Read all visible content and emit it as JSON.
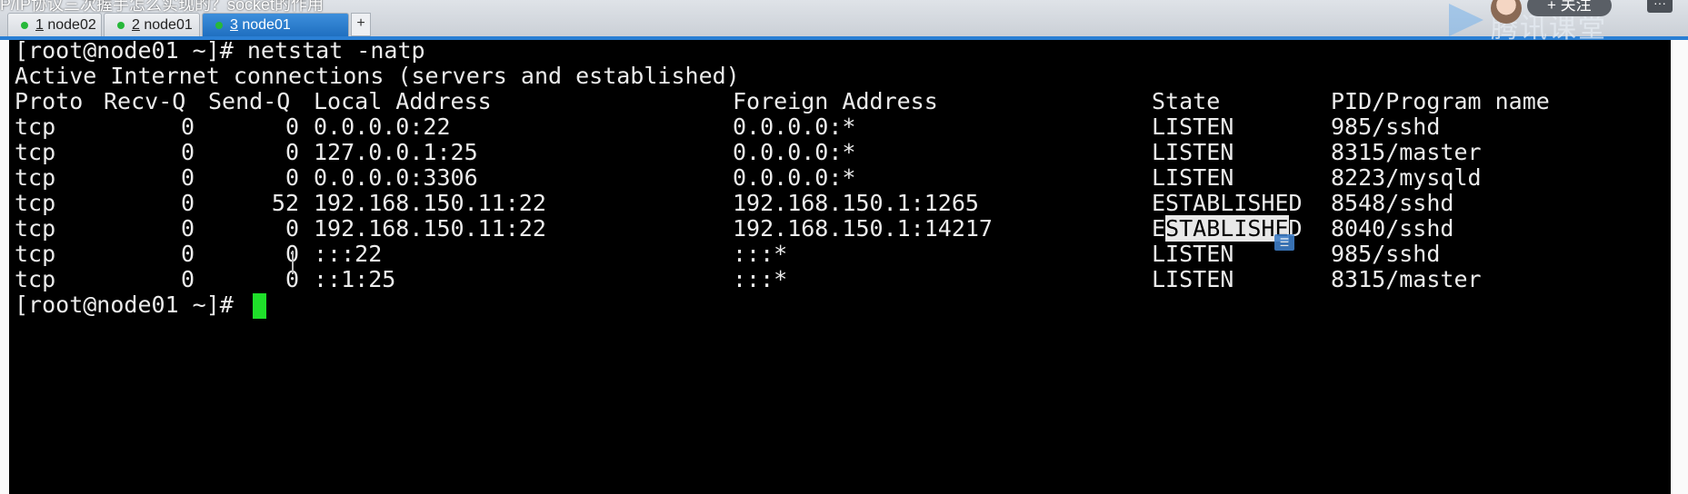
{
  "video_title": "P/IP协议三次握手怎么实现的？socket的作用",
  "tabs": [
    {
      "num": "1",
      "label": " node02",
      "active": false
    },
    {
      "num": "2",
      "label": " node01",
      "active": false
    },
    {
      "num": "3",
      "label": " node01",
      "active": true
    }
  ],
  "tab_add_label": "+",
  "overlay": {
    "logo_text": "腾讯课堂",
    "follow_label": "+ 关注",
    "more_label": "···"
  },
  "terminal": {
    "prompt": "[root@node01 ~]# ",
    "command": "netstat -natp",
    "summary": "Active Internet connections (servers and established)",
    "headers": {
      "proto": "Proto",
      "recvq": "Recv-Q",
      "sendq": "Send-Q",
      "local": "Local Address",
      "foreign": "Foreign Address",
      "state": "State",
      "pid": "PID/Program name"
    },
    "rows": [
      {
        "proto": "tcp",
        "recvq": "0",
        "sendq": "0",
        "local": "0.0.0.0:22",
        "foreign": "0.0.0.0:*",
        "state": "LISTEN",
        "pid": "985/sshd"
      },
      {
        "proto": "tcp",
        "recvq": "0",
        "sendq": "0",
        "local": "127.0.0.1:25",
        "foreign": "0.0.0.0:*",
        "state": "LISTEN",
        "pid": "8315/master"
      },
      {
        "proto": "tcp",
        "recvq": "0",
        "sendq": "0",
        "local": "0.0.0.0:3306",
        "foreign": "0.0.0.0:*",
        "state": "LISTEN",
        "pid": "8223/mysqld"
      },
      {
        "proto": "tcp",
        "recvq": "0",
        "sendq": "52",
        "local": "192.168.150.11:22",
        "foreign": "192.168.150.1:1265",
        "state": "ESTABLISHED",
        "pid": "8548/sshd"
      },
      {
        "proto": "tcp",
        "recvq": "0",
        "sendq": "0",
        "local": "192.168.150.11:22",
        "foreign": "192.168.150.1:14217",
        "state": "ESTABLISHED",
        "pid": "8040/sshd"
      },
      {
        "proto": "tcp",
        "recvq": "0",
        "sendq": "0",
        "local": ":::22",
        "foreign": ":::*",
        "state": "LISTEN",
        "pid": "985/sshd"
      },
      {
        "proto": "tcp",
        "recvq": "0",
        "sendq": "0",
        "local": "::1:25",
        "foreign": ":::*",
        "state": "LISTEN",
        "pid": "8315/master"
      }
    ],
    "selected_state_text": "STABLISHE",
    "final_prompt": "[root@node01 ~]# "
  },
  "colors": {
    "cursor": "#1fe02a",
    "tab_active": "#2a7fd4",
    "terminal_bg": "#000000"
  }
}
